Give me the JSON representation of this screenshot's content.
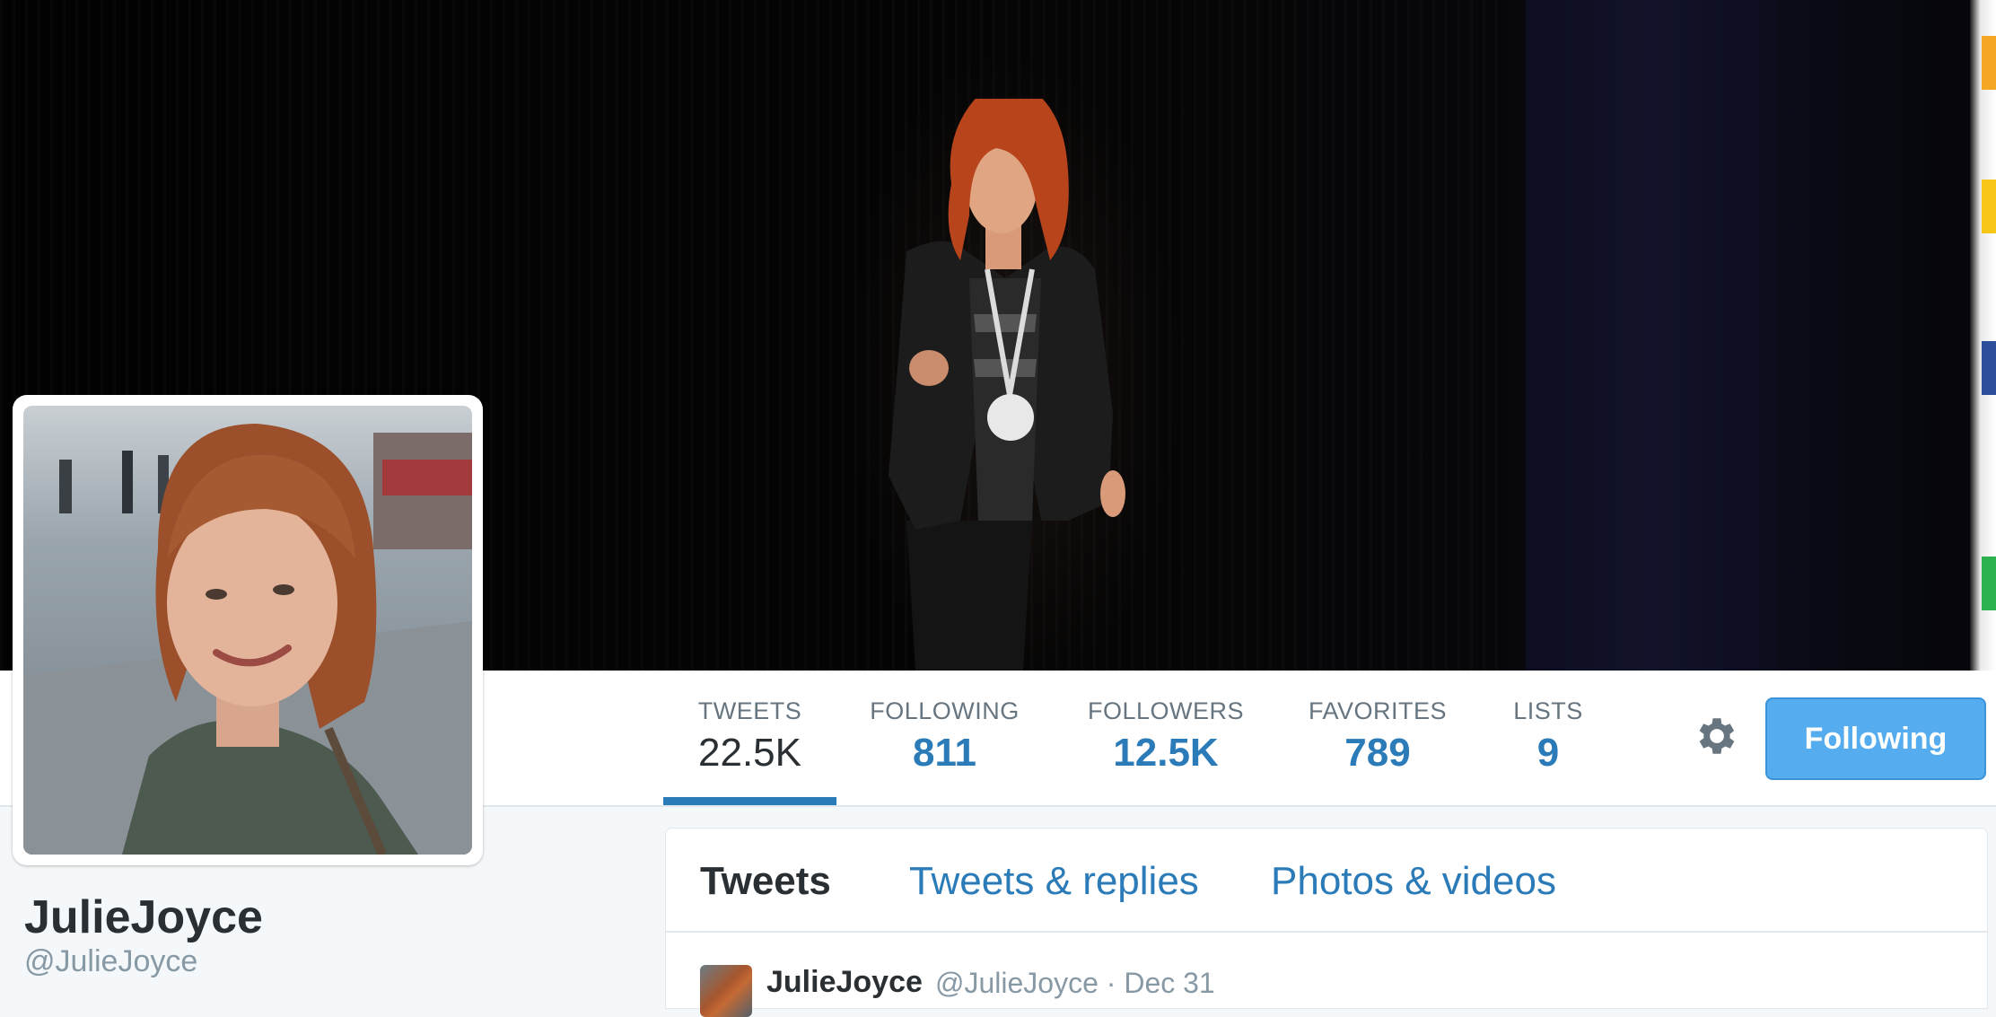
{
  "profile": {
    "display_name": "JulieJoyce",
    "screen_name": "@JulieJoyce"
  },
  "stats": [
    {
      "label": "TWEETS",
      "value": "22.5K"
    },
    {
      "label": "FOLLOWING",
      "value": "811"
    },
    {
      "label": "FOLLOWERS",
      "value": "12.5K"
    },
    {
      "label": "FAVORITES",
      "value": "789"
    },
    {
      "label": "LISTS",
      "value": "9"
    }
  ],
  "actions": {
    "follow_label": "Following",
    "settings_icon": "gear-icon"
  },
  "timeline": {
    "tabs": [
      {
        "label": "Tweets"
      },
      {
        "label": "Tweets & replies"
      },
      {
        "label": "Photos & videos"
      }
    ],
    "first_tweet": {
      "name": "JulieJoyce",
      "handle": "@JulieJoyce",
      "separator": "·",
      "date": "Dec 31"
    }
  },
  "colors": {
    "accent": "#2b7bb9",
    "button": "#55acee",
    "text": "#292f33",
    "muted": "#8899a6",
    "background": "#f5f8fa"
  }
}
